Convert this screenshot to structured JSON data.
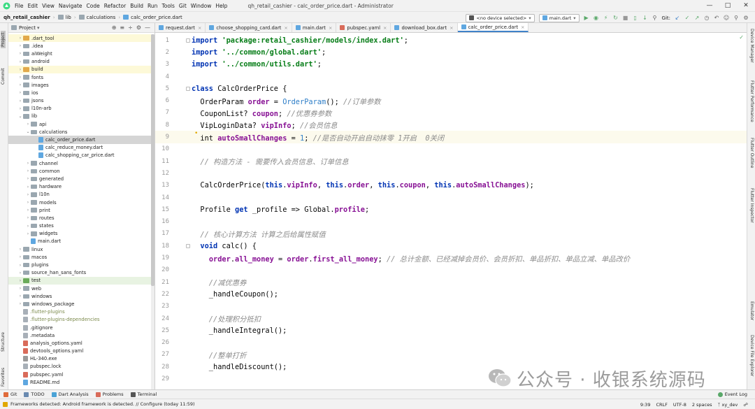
{
  "menubar": {
    "items": [
      "File",
      "Edit",
      "View",
      "Navigate",
      "Code",
      "Refactor",
      "Build",
      "Run",
      "Tools",
      "Git",
      "Window",
      "Help"
    ],
    "window_title": "qh_retail_cashier - calc_order_price.dart - Administrator"
  },
  "breadcrumb": {
    "project": "qh_retail_cashier",
    "parts": [
      "lib",
      "calculations",
      "calc_order_price.dart"
    ]
  },
  "toolbar": {
    "device_selector": "<no device selected>",
    "run_config": "main.dart",
    "git_label": "Git:"
  },
  "left_strip": {
    "project": "Project",
    "commit": "Commit",
    "structure": "Structure",
    "favorites": "Favorites"
  },
  "right_strip": {
    "device_manager": "Device Manager",
    "flutter_performance": "Flutter Performance",
    "flutter_outline": "Flutter Outline",
    "flutter_inspector": "Flutter Inspector",
    "emulator": "Emulator",
    "device_file_explorer": "Device File Explorer"
  },
  "project_panel": {
    "title": "Project",
    "tree": [
      {
        "label": ".dart_tool",
        "indent": 1,
        "arrow": ">",
        "kind": "folder-orange",
        "hl": "yellow"
      },
      {
        "label": ".idea",
        "indent": 1,
        "arrow": ">",
        "kind": "folder",
        "hl": ""
      },
      {
        "label": "aiWeight",
        "indent": 1,
        "arrow": ">",
        "kind": "folder",
        "hl": ""
      },
      {
        "label": "android",
        "indent": 1,
        "arrow": ">",
        "kind": "folder",
        "hl": ""
      },
      {
        "label": "build",
        "indent": 1,
        "arrow": ">",
        "kind": "folder-orange",
        "hl": "yellow"
      },
      {
        "label": "fonts",
        "indent": 1,
        "arrow": ">",
        "kind": "folder",
        "hl": ""
      },
      {
        "label": "images",
        "indent": 1,
        "arrow": ">",
        "kind": "folder",
        "hl": ""
      },
      {
        "label": "ios",
        "indent": 1,
        "arrow": ">",
        "kind": "folder",
        "hl": ""
      },
      {
        "label": "jsons",
        "indent": 1,
        "arrow": ">",
        "kind": "folder",
        "hl": ""
      },
      {
        "label": "l10n-arb",
        "indent": 1,
        "arrow": ">",
        "kind": "folder",
        "hl": ""
      },
      {
        "label": "lib",
        "indent": 1,
        "arrow": "v",
        "kind": "folder",
        "hl": ""
      },
      {
        "label": "api",
        "indent": 2,
        "arrow": ">",
        "kind": "folder",
        "hl": ""
      },
      {
        "label": "calculations",
        "indent": 2,
        "arrow": "v",
        "kind": "folder",
        "hl": ""
      },
      {
        "label": "calc_order_price.dart",
        "indent": 3,
        "arrow": "",
        "kind": "dart",
        "hl": "selected"
      },
      {
        "label": "calc_reduce_money.dart",
        "indent": 3,
        "arrow": "",
        "kind": "dart",
        "hl": ""
      },
      {
        "label": "calc_shopping_car_price.dart",
        "indent": 3,
        "arrow": "",
        "kind": "dart",
        "hl": ""
      },
      {
        "label": "channel",
        "indent": 2,
        "arrow": ">",
        "kind": "folder",
        "hl": ""
      },
      {
        "label": "common",
        "indent": 2,
        "arrow": ">",
        "kind": "folder",
        "hl": ""
      },
      {
        "label": "generated",
        "indent": 2,
        "arrow": ">",
        "kind": "folder",
        "hl": ""
      },
      {
        "label": "hardware",
        "indent": 2,
        "arrow": ">",
        "kind": "folder",
        "hl": ""
      },
      {
        "label": "l10n",
        "indent": 2,
        "arrow": ">",
        "kind": "folder",
        "hl": ""
      },
      {
        "label": "models",
        "indent": 2,
        "arrow": ">",
        "kind": "folder",
        "hl": ""
      },
      {
        "label": "print",
        "indent": 2,
        "arrow": ">",
        "kind": "folder",
        "hl": ""
      },
      {
        "label": "routes",
        "indent": 2,
        "arrow": ">",
        "kind": "folder",
        "hl": ""
      },
      {
        "label": "states",
        "indent": 2,
        "arrow": ">",
        "kind": "folder",
        "hl": ""
      },
      {
        "label": "widgets",
        "indent": 2,
        "arrow": ">",
        "kind": "folder",
        "hl": ""
      },
      {
        "label": "main.dart",
        "indent": 2,
        "arrow": "",
        "kind": "dart",
        "hl": ""
      },
      {
        "label": "linux",
        "indent": 1,
        "arrow": ">",
        "kind": "folder",
        "hl": ""
      },
      {
        "label": "macos",
        "indent": 1,
        "arrow": ">",
        "kind": "folder",
        "hl": ""
      },
      {
        "label": "plugins",
        "indent": 1,
        "arrow": ">",
        "kind": "folder",
        "hl": ""
      },
      {
        "label": "source_han_sans_fonts",
        "indent": 1,
        "arrow": ">",
        "kind": "folder",
        "hl": ""
      },
      {
        "label": "test",
        "indent": 1,
        "arrow": ">",
        "kind": "folder-green",
        "hl": "green"
      },
      {
        "label": "web",
        "indent": 1,
        "arrow": ">",
        "kind": "folder",
        "hl": ""
      },
      {
        "label": "windows",
        "indent": 1,
        "arrow": ">",
        "kind": "folder",
        "hl": ""
      },
      {
        "label": "windows_package",
        "indent": 1,
        "arrow": ">",
        "kind": "folder",
        "hl": ""
      },
      {
        "label": ".flutter-plugins",
        "indent": 1,
        "arrow": "",
        "kind": "plain-ol",
        "hl": ""
      },
      {
        "label": ".flutter-plugins-dependencies",
        "indent": 1,
        "arrow": "",
        "kind": "plain-ol",
        "hl": ""
      },
      {
        "label": ".gitignore",
        "indent": 1,
        "arrow": "",
        "kind": "plain",
        "hl": ""
      },
      {
        "label": ".metadata",
        "indent": 1,
        "arrow": "",
        "kind": "plain",
        "hl": ""
      },
      {
        "label": "analysis_options.yaml",
        "indent": 1,
        "arrow": "",
        "kind": "red",
        "hl": ""
      },
      {
        "label": "devtools_options.yaml",
        "indent": 1,
        "arrow": "",
        "kind": "red",
        "hl": ""
      },
      {
        "label": "HL-340.exe",
        "indent": 1,
        "arrow": "",
        "kind": "gray",
        "hl": ""
      },
      {
        "label": "pubspec.lock",
        "indent": 1,
        "arrow": "",
        "kind": "plain",
        "hl": ""
      },
      {
        "label": "pubspec.yaml",
        "indent": 1,
        "arrow": "",
        "kind": "red",
        "hl": ""
      },
      {
        "label": "README.md",
        "indent": 1,
        "arrow": "",
        "kind": "dart",
        "hl": ""
      }
    ]
  },
  "editor_tabs": [
    {
      "label": "request.dart",
      "active": false
    },
    {
      "label": "choose_shopping_card.dart",
      "active": false
    },
    {
      "label": "main.dart",
      "active": false
    },
    {
      "label": "pubspec.yaml",
      "active": false
    },
    {
      "label": "download_box.dart",
      "active": false
    },
    {
      "label": "calc_order_price.dart",
      "active": true
    }
  ],
  "code_lines": [
    {
      "n": "1",
      "tokens": [
        [
          "kw",
          "import "
        ],
        [
          "str",
          "'package:retail_cashier/models/index.dart'"
        ],
        [
          "pln",
          ";"
        ]
      ]
    },
    {
      "n": "2",
      "tokens": [
        [
          "kw",
          "import "
        ],
        [
          "str",
          "'../common/global.dart'"
        ],
        [
          "pln",
          ";"
        ]
      ]
    },
    {
      "n": "3",
      "tokens": [
        [
          "kw",
          "import "
        ],
        [
          "str",
          "'../common/utils.dart'"
        ],
        [
          "pln",
          ";"
        ]
      ]
    },
    {
      "n": "4",
      "tokens": []
    },
    {
      "n": "5",
      "tokens": [
        [
          "kw",
          "class "
        ],
        [
          "pln",
          "CalcOrderPrice {"
        ]
      ]
    },
    {
      "n": "6",
      "tokens": [
        [
          "pln",
          "  OrderParam "
        ],
        [
          "fld",
          "order"
        ],
        [
          "pln",
          " = "
        ],
        [
          "typ",
          "OrderParam"
        ],
        [
          "pln",
          "(); "
        ],
        [
          "cmt",
          "//订单参数"
        ]
      ]
    },
    {
      "n": "7",
      "tokens": [
        [
          "pln",
          "  CouponList? "
        ],
        [
          "fld",
          "coupon"
        ],
        [
          "pln",
          "; "
        ],
        [
          "cmt",
          "//优惠券参数"
        ]
      ]
    },
    {
      "n": "8",
      "tokens": [
        [
          "pln",
          "  VipLoginData? "
        ],
        [
          "fld",
          "vipInfo"
        ],
        [
          "pln",
          "; "
        ],
        [
          "cmt",
          "//会员信息"
        ]
      ]
    },
    {
      "n": "9",
      "tokens": [
        [
          "pln",
          "  int "
        ],
        [
          "fld",
          "autoSmallChanges"
        ],
        [
          "pln",
          " = "
        ],
        [
          "typ",
          "1"
        ],
        [
          "pln",
          "; "
        ],
        [
          "cmt",
          "//是否自动开启自动抹零 1开启  0关闭"
        ]
      ]
    },
    {
      "n": "10",
      "tokens": []
    },
    {
      "n": "11",
      "tokens": [
        [
          "cmt",
          "  // 构造方法 - 需要传入会员信息、订单信息"
        ]
      ]
    },
    {
      "n": "12",
      "tokens": []
    },
    {
      "n": "13",
      "tokens": [
        [
          "pln",
          "  CalcOrderPrice("
        ],
        [
          "kw",
          "this"
        ],
        [
          "pln",
          "."
        ],
        [
          "fld",
          "vipInfo"
        ],
        [
          "pln",
          ", "
        ],
        [
          "kw",
          "this"
        ],
        [
          "pln",
          "."
        ],
        [
          "fld",
          "order"
        ],
        [
          "pln",
          ", "
        ],
        [
          "kw",
          "this"
        ],
        [
          "pln",
          "."
        ],
        [
          "fld",
          "coupon"
        ],
        [
          "pln",
          ", "
        ],
        [
          "kw",
          "this"
        ],
        [
          "pln",
          "."
        ],
        [
          "fld",
          "autoSmallChanges"
        ],
        [
          "pln",
          ");"
        ]
      ]
    },
    {
      "n": "14",
      "tokens": []
    },
    {
      "n": "15",
      "tokens": [
        [
          "pln",
          "  Profile "
        ],
        [
          "kw",
          "get "
        ],
        [
          "pln",
          "_profile => Global."
        ],
        [
          "fld",
          "profile"
        ],
        [
          "pln",
          ";"
        ]
      ]
    },
    {
      "n": "16",
      "tokens": []
    },
    {
      "n": "17",
      "tokens": [
        [
          "cmt",
          "  // 核心计算方法 计算之后给属性赋值"
        ]
      ]
    },
    {
      "n": "18",
      "tokens": [
        [
          "pln",
          "  "
        ],
        [
          "kw",
          "void "
        ],
        [
          "pln",
          "calc() {"
        ]
      ]
    },
    {
      "n": "19",
      "tokens": [
        [
          "pln",
          "    "
        ],
        [
          "fld",
          "order"
        ],
        [
          "pln",
          "."
        ],
        [
          "fld",
          "all_money"
        ],
        [
          "pln",
          " = "
        ],
        [
          "fld",
          "order"
        ],
        [
          "pln",
          "."
        ],
        [
          "fld",
          "first_all_money"
        ],
        [
          "pln",
          "; "
        ],
        [
          "cmt",
          "// 总计金额、已经减掉会员价、会员折扣、单品折扣、单品立减、单品改价"
        ]
      ]
    },
    {
      "n": "20",
      "tokens": []
    },
    {
      "n": "21",
      "tokens": [
        [
          "cmt",
          "    //减优惠券"
        ]
      ]
    },
    {
      "n": "22",
      "tokens": [
        [
          "pln",
          "    _handleCoupon();"
        ]
      ]
    },
    {
      "n": "23",
      "tokens": []
    },
    {
      "n": "24",
      "tokens": [
        [
          "cmt",
          "    //处理积分抵扣"
        ]
      ]
    },
    {
      "n": "25",
      "tokens": [
        [
          "pln",
          "    _handleIntegral();"
        ]
      ]
    },
    {
      "n": "26",
      "tokens": []
    },
    {
      "n": "27",
      "tokens": [
        [
          "cmt",
          "    //整单打折"
        ]
      ]
    },
    {
      "n": "28",
      "tokens": [
        [
          "pln",
          "    _handleDiscount();"
        ]
      ]
    },
    {
      "n": "29",
      "tokens": []
    }
  ],
  "watermark": {
    "text": "公众号 · 收银系统源码"
  },
  "bottom_tools": [
    {
      "label": "Git",
      "color": "#e06b3a"
    },
    {
      "label": "TODO",
      "color": "#6a8ab0"
    },
    {
      "label": "Dart Analysis",
      "color": "#4ba3d6"
    },
    {
      "label": "Problems",
      "color": "#d96b5a"
    },
    {
      "label": "Terminal",
      "color": "#555555"
    }
  ],
  "event_log": "Event Log",
  "status_bar": {
    "message": "Frameworks detected: Android framework is detected. // Configure (today 11:59)",
    "position": "9:39",
    "line_sep": "CRLF",
    "encoding": "UTF-8",
    "indent": "2 spaces",
    "branch": "xy_dev"
  },
  "colors": {
    "accent": "#4083c9",
    "keyword": "#0033b3",
    "string": "#067d17",
    "field": "#871094"
  }
}
